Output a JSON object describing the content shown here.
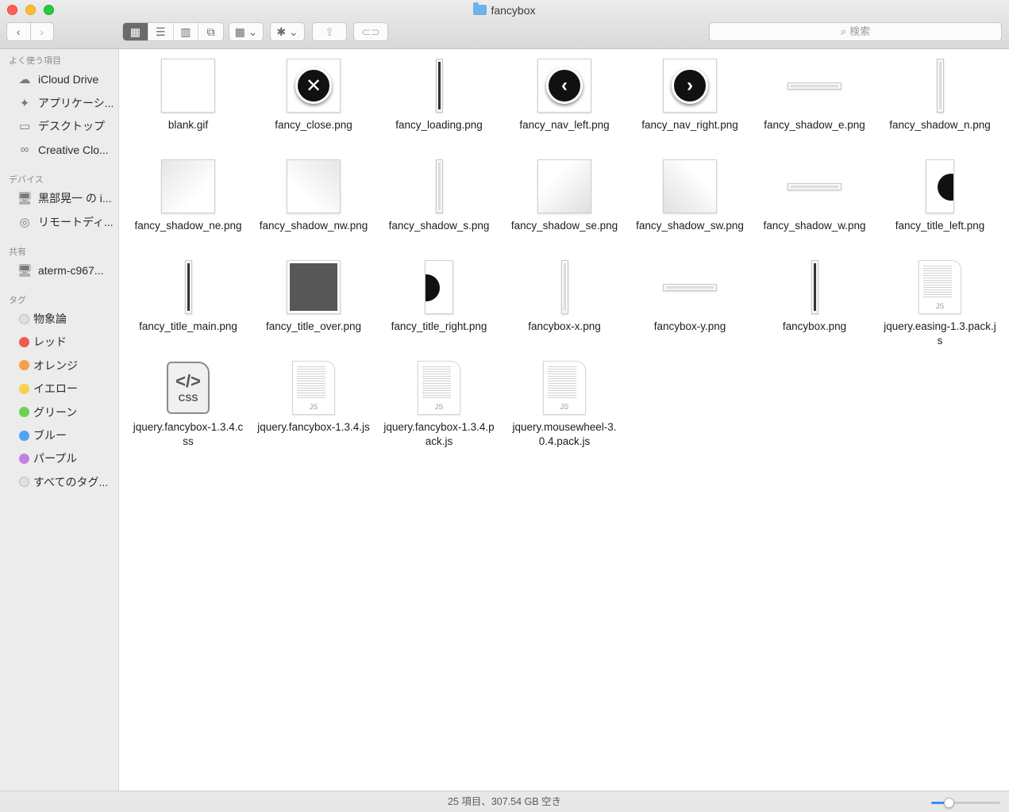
{
  "window": {
    "title": "fancybox",
    "title_icon": "folder-icon"
  },
  "toolbar": {
    "back_glyph": "‹",
    "forward_glyph": "›",
    "view_modes": [
      {
        "icon": "icon-view-icon",
        "glyph": "▦",
        "active": true
      },
      {
        "icon": "list-view-icon",
        "glyph": "☰",
        "active": false
      },
      {
        "icon": "column-view-icon",
        "glyph": "▥",
        "active": false
      },
      {
        "icon": "cover-flow-icon",
        "glyph": "⧉",
        "active": false
      }
    ],
    "arrange_glyph": "▦ ⌄",
    "action_glyph": "✱ ⌄",
    "share_glyph": "⇪",
    "tag_glyph": "⊂⊃",
    "search_placeholder": "検索",
    "search_icon": "🔍"
  },
  "sidebar": {
    "sections": [
      {
        "header": "よく使う項目",
        "items": [
          {
            "label": "iCloud Drive",
            "icon": "cloud-icon",
            "glyph": "☁"
          },
          {
            "label": "アプリケーシ...",
            "icon": "applications-icon",
            "glyph": "✦"
          },
          {
            "label": "デスクトップ",
            "icon": "desktop-icon",
            "glyph": "▭"
          },
          {
            "label": "Creative Clo...",
            "icon": "creative-cloud-icon",
            "glyph": "∞"
          }
        ]
      },
      {
        "header": "デバイス",
        "items": [
          {
            "label": "黒部晃一 の i...",
            "icon": "computer-icon",
            "glyph": "🖥"
          },
          {
            "label": "リモートディ...",
            "icon": "disc-icon",
            "glyph": "◎"
          }
        ]
      },
      {
        "header": "共有",
        "items": [
          {
            "label": "aterm-c967...",
            "icon": "network-computer-icon",
            "glyph": "🖥"
          }
        ]
      },
      {
        "header": "タグ",
        "tags": [
          {
            "label": "物象論",
            "color": "#e0e0e0"
          },
          {
            "label": "レッド",
            "color": "#f05a4f"
          },
          {
            "label": "オレンジ",
            "color": "#f5a04a"
          },
          {
            "label": "イエロー",
            "color": "#f6d34a"
          },
          {
            "label": "グリーン",
            "color": "#6fcf56"
          },
          {
            "label": "ブルー",
            "color": "#4da3f7"
          },
          {
            "label": "パープル",
            "color": "#c480e0"
          },
          {
            "label": "すべてのタグ...",
            "color": "#e0e0e0"
          }
        ]
      }
    ]
  },
  "files": [
    {
      "name": "blank.gif",
      "kind": "box"
    },
    {
      "name": "fancy_close.png",
      "kind": "circle",
      "glyph": "✕"
    },
    {
      "name": "fancy_loading.png",
      "kind": "vbar-dark"
    },
    {
      "name": "fancy_nav_left.png",
      "kind": "circle",
      "glyph": "‹"
    },
    {
      "name": "fancy_nav_right.png",
      "kind": "circle",
      "glyph": "›"
    },
    {
      "name": "fancy_shadow_e.png",
      "kind": "hbar"
    },
    {
      "name": "fancy_shadow_n.png",
      "kind": "vbar-light"
    },
    {
      "name": "fancy_shadow_ne.png",
      "kind": "grad"
    },
    {
      "name": "fancy_shadow_nw.png",
      "kind": "grad2"
    },
    {
      "name": "fancy_shadow_s.png",
      "kind": "vbar-light"
    },
    {
      "name": "fancy_shadow_se.png",
      "kind": "grad3"
    },
    {
      "name": "fancy_shadow_sw.png",
      "kind": "grad4"
    },
    {
      "name": "fancy_shadow_w.png",
      "kind": "hbar"
    },
    {
      "name": "fancy_title_left.png",
      "kind": "half-left"
    },
    {
      "name": "fancy_title_main.png",
      "kind": "vbar-dark"
    },
    {
      "name": "fancy_title_over.png",
      "kind": "dark"
    },
    {
      "name": "fancy_title_right.png",
      "kind": "half-right"
    },
    {
      "name": "fancybox-x.png",
      "kind": "vbar-light"
    },
    {
      "name": "fancybox-y.png",
      "kind": "hbar"
    },
    {
      "name": "fancybox.png",
      "kind": "vbar-dark"
    },
    {
      "name": "jquery.easing-1.3.pack.js",
      "kind": "doc",
      "ext": "JS"
    },
    {
      "name": "jquery.fancybox-1.3.4.css",
      "kind": "css",
      "code": "</>",
      "ext": "CSS"
    },
    {
      "name": "jquery.fancybox-1.3.4.js",
      "kind": "doc",
      "ext": "JS"
    },
    {
      "name": "jquery.fancybox-1.3.4.pack.js",
      "kind": "doc",
      "ext": "JS"
    },
    {
      "name": "jquery.mousewheel-3.0.4.pack.js",
      "kind": "doc",
      "ext": "JS"
    }
  ],
  "status": {
    "text": "25 項目、307.54 GB 空き",
    "icon_size_fraction": 0.25
  }
}
